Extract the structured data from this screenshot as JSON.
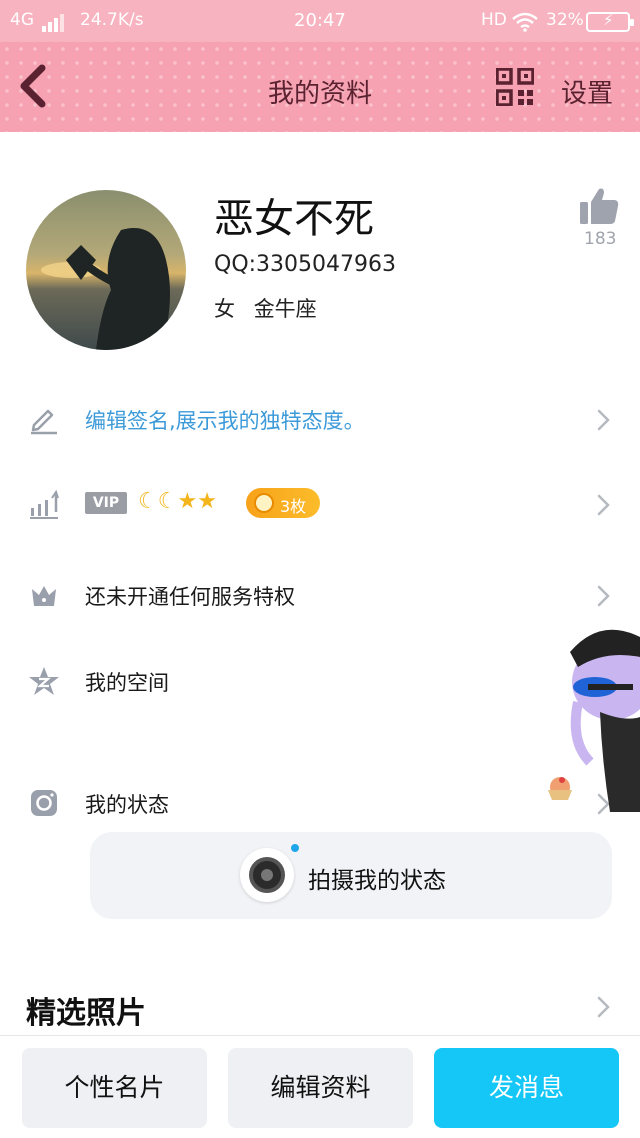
{
  "status_bar": {
    "network": "4G",
    "speed": "24.7K/s",
    "time": "20:47",
    "hd": "HD",
    "battery": "32%"
  },
  "nav": {
    "title": "我的资料",
    "settings": "设置",
    "back_icon": "chevron-left-icon",
    "qr_icon": "qr-code-icon"
  },
  "profile": {
    "nickname": "恶女不死",
    "qq": "QQ:3305047963",
    "gender": "女",
    "zodiac": "金牛座",
    "likes": "183"
  },
  "rows": {
    "signature": "编辑签名,展示我的独特态度。",
    "vip_badge": "VIP",
    "coins": "3枚",
    "privilege": "还未开通任何服务特权",
    "space": "我的空间",
    "status": "我的状态"
  },
  "capture": {
    "label": "拍摄我的状态"
  },
  "photos": {
    "title": "精选照片"
  },
  "bottom": {
    "card": "个性名片",
    "edit": "编辑资料",
    "message": "发消息"
  },
  "colors": {
    "header_pink": "#f6a2b2",
    "status_pink": "#f7b3bf",
    "accent_blue": "#15c7f7",
    "signature_blue": "#3d9ad9",
    "coin_orange": "#f7a21a"
  }
}
